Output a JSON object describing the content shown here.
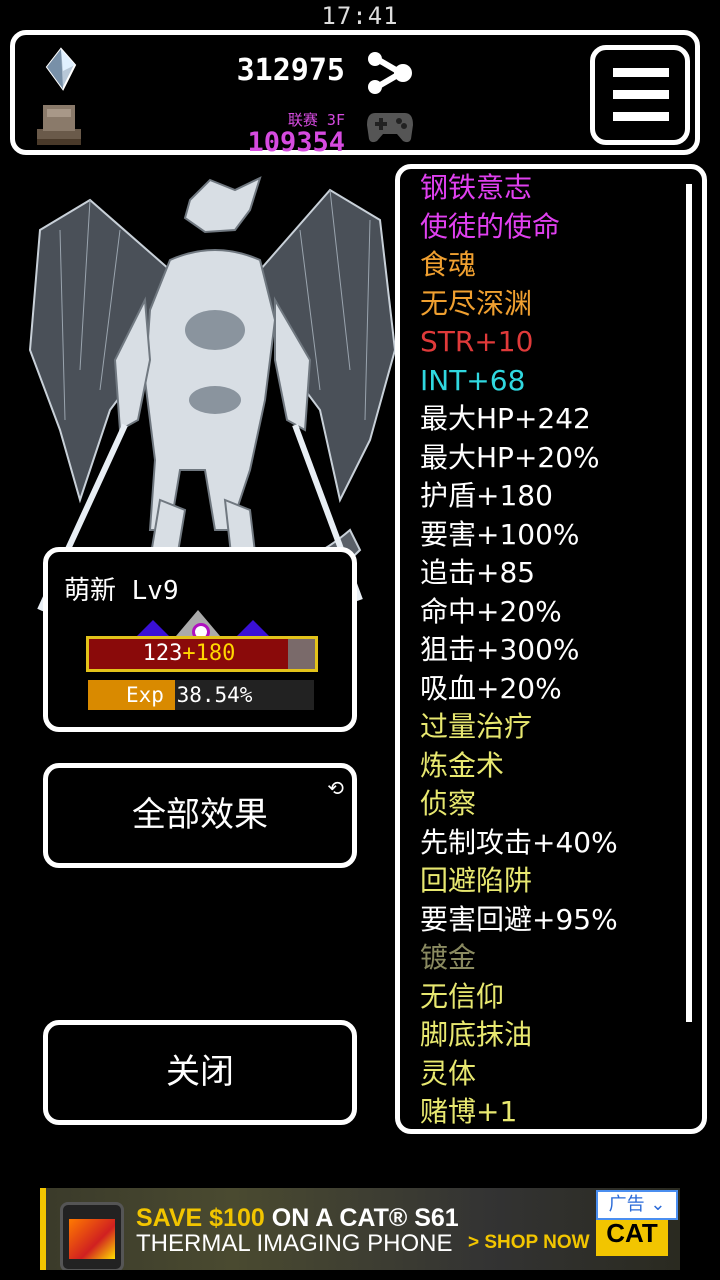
{
  "status_bar": {
    "time": "17:41"
  },
  "resources": {
    "gold": "312975",
    "league_label": "联赛 3F",
    "gems": "109354"
  },
  "character": {
    "name": "萌新 Lv9",
    "hp_base": "123",
    "hp_bonus": "+180",
    "hp_fill_fraction": 0.88,
    "exp_label": "Exp",
    "exp_value": "38.54%",
    "exp_fraction": 0.3854
  },
  "buttons": {
    "all_effects": "全部效果",
    "close": "关闭"
  },
  "effects": [
    {
      "text": "钢铁意志",
      "color": "#e040f0"
    },
    {
      "text": "使徒的使命",
      "color": "#e040f0"
    },
    {
      "text": "食魂",
      "color": "#f0a030"
    },
    {
      "text": "无尽深渊",
      "color": "#f0a030"
    },
    {
      "text": "STR+10",
      "color": "#e03a3a"
    },
    {
      "text": "INT+68",
      "color": "#30d8e0"
    },
    {
      "text": "最大HP+242",
      "color": "#ffffff"
    },
    {
      "text": "最大HP+20%",
      "color": "#ffffff"
    },
    {
      "text": "护盾+180",
      "color": "#ffffff"
    },
    {
      "text": "要害+100%",
      "color": "#ffffff"
    },
    {
      "text": "追击+85",
      "color": "#ffffff"
    },
    {
      "text": "命中+20%",
      "color": "#ffffff"
    },
    {
      "text": "狙击+300%",
      "color": "#ffffff"
    },
    {
      "text": "吸血+20%",
      "color": "#ffffff"
    },
    {
      "text": "过量治疗",
      "color": "#e8e870"
    },
    {
      "text": "炼金术",
      "color": "#e8e870"
    },
    {
      "text": "侦察",
      "color": "#e8e870"
    },
    {
      "text": "先制攻击+40%",
      "color": "#ffffff"
    },
    {
      "text": "回避陷阱",
      "color": "#e8e870"
    },
    {
      "text": "要害回避+95%",
      "color": "#ffffff"
    },
    {
      "text": "镀金",
      "color": "#8a8a60"
    },
    {
      "text": "无信仰",
      "color": "#e8e870"
    },
    {
      "text": "脚底抹油",
      "color": "#e8e870"
    },
    {
      "text": "灵体",
      "color": "#e8e870"
    },
    {
      "text": "赌博+1",
      "color": "#e8e870"
    }
  ],
  "ad": {
    "line1_highlight": "SAVE $100",
    "line1_rest": " ON A CAT® S61",
    "line2": "THERMAL IMAGING PHONE",
    "cta": "> SHOP NOW",
    "logo": "CAT",
    "tag": "广告"
  },
  "icons": {
    "crystal": "crystal-icon",
    "altar": "altar-icon",
    "share": "share-icon",
    "gamepad": "gamepad-icon",
    "menu": "hamburger-menu-icon",
    "refresh": "refresh-icon"
  }
}
